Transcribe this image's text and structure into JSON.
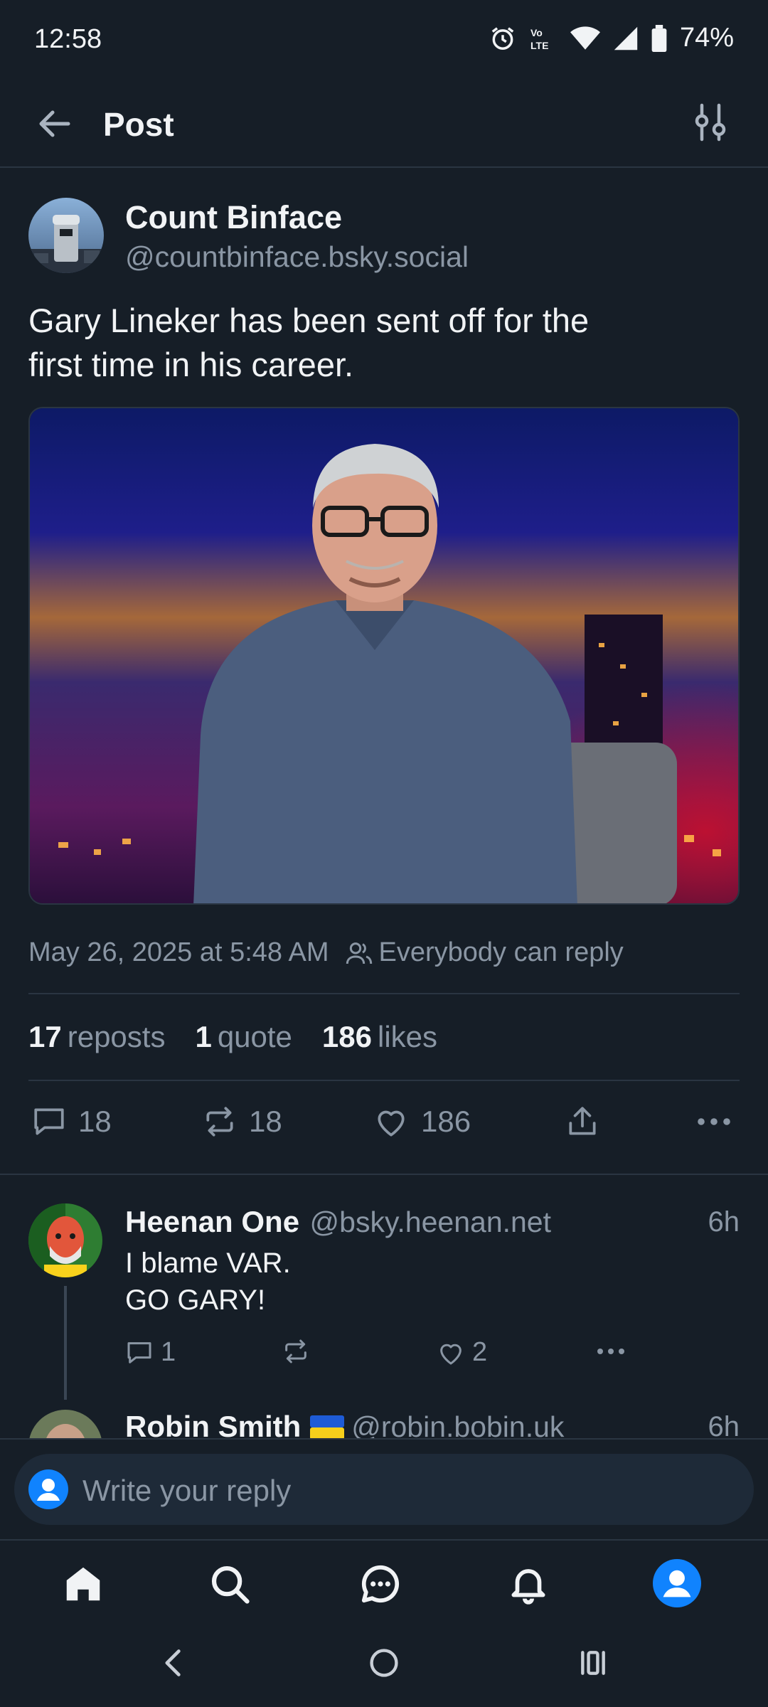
{
  "status_bar": {
    "time": "12:58",
    "battery": "74%",
    "network": "VoLTE"
  },
  "header": {
    "title": "Post"
  },
  "post": {
    "author_name": "Count Binface",
    "author_handle": "@countbinface.bsky.social",
    "text_line1": "Gary Lineker has been sent off for the",
    "text_line2": "first time in his career.",
    "timestamp": "May 26, 2025 at 5:48 AM",
    "reply_setting": "Everybody can reply",
    "reposts_count": "17",
    "reposts_label": "reposts",
    "quotes_count": "1",
    "quotes_label": "quote",
    "likes_count": "186",
    "likes_label": "likes",
    "action_replies": "18",
    "action_reposts": "18",
    "action_likes": "186"
  },
  "replies": [
    {
      "name": "Heenan One",
      "handle": "@bsky.heenan.net",
      "time": "6h",
      "line1": "I blame VAR.",
      "line2": "GO GARY!",
      "replies": "1",
      "likes": "2"
    },
    {
      "name": "Robin Smith",
      "flag": "🇺🇦",
      "handle": "@robin.bobin.uk",
      "time": "6h"
    }
  ],
  "composer": {
    "placeholder": "Write your reply"
  },
  "colors": {
    "accent": "#1083fe",
    "background": "#161e27",
    "muted": "#8a96a4"
  }
}
